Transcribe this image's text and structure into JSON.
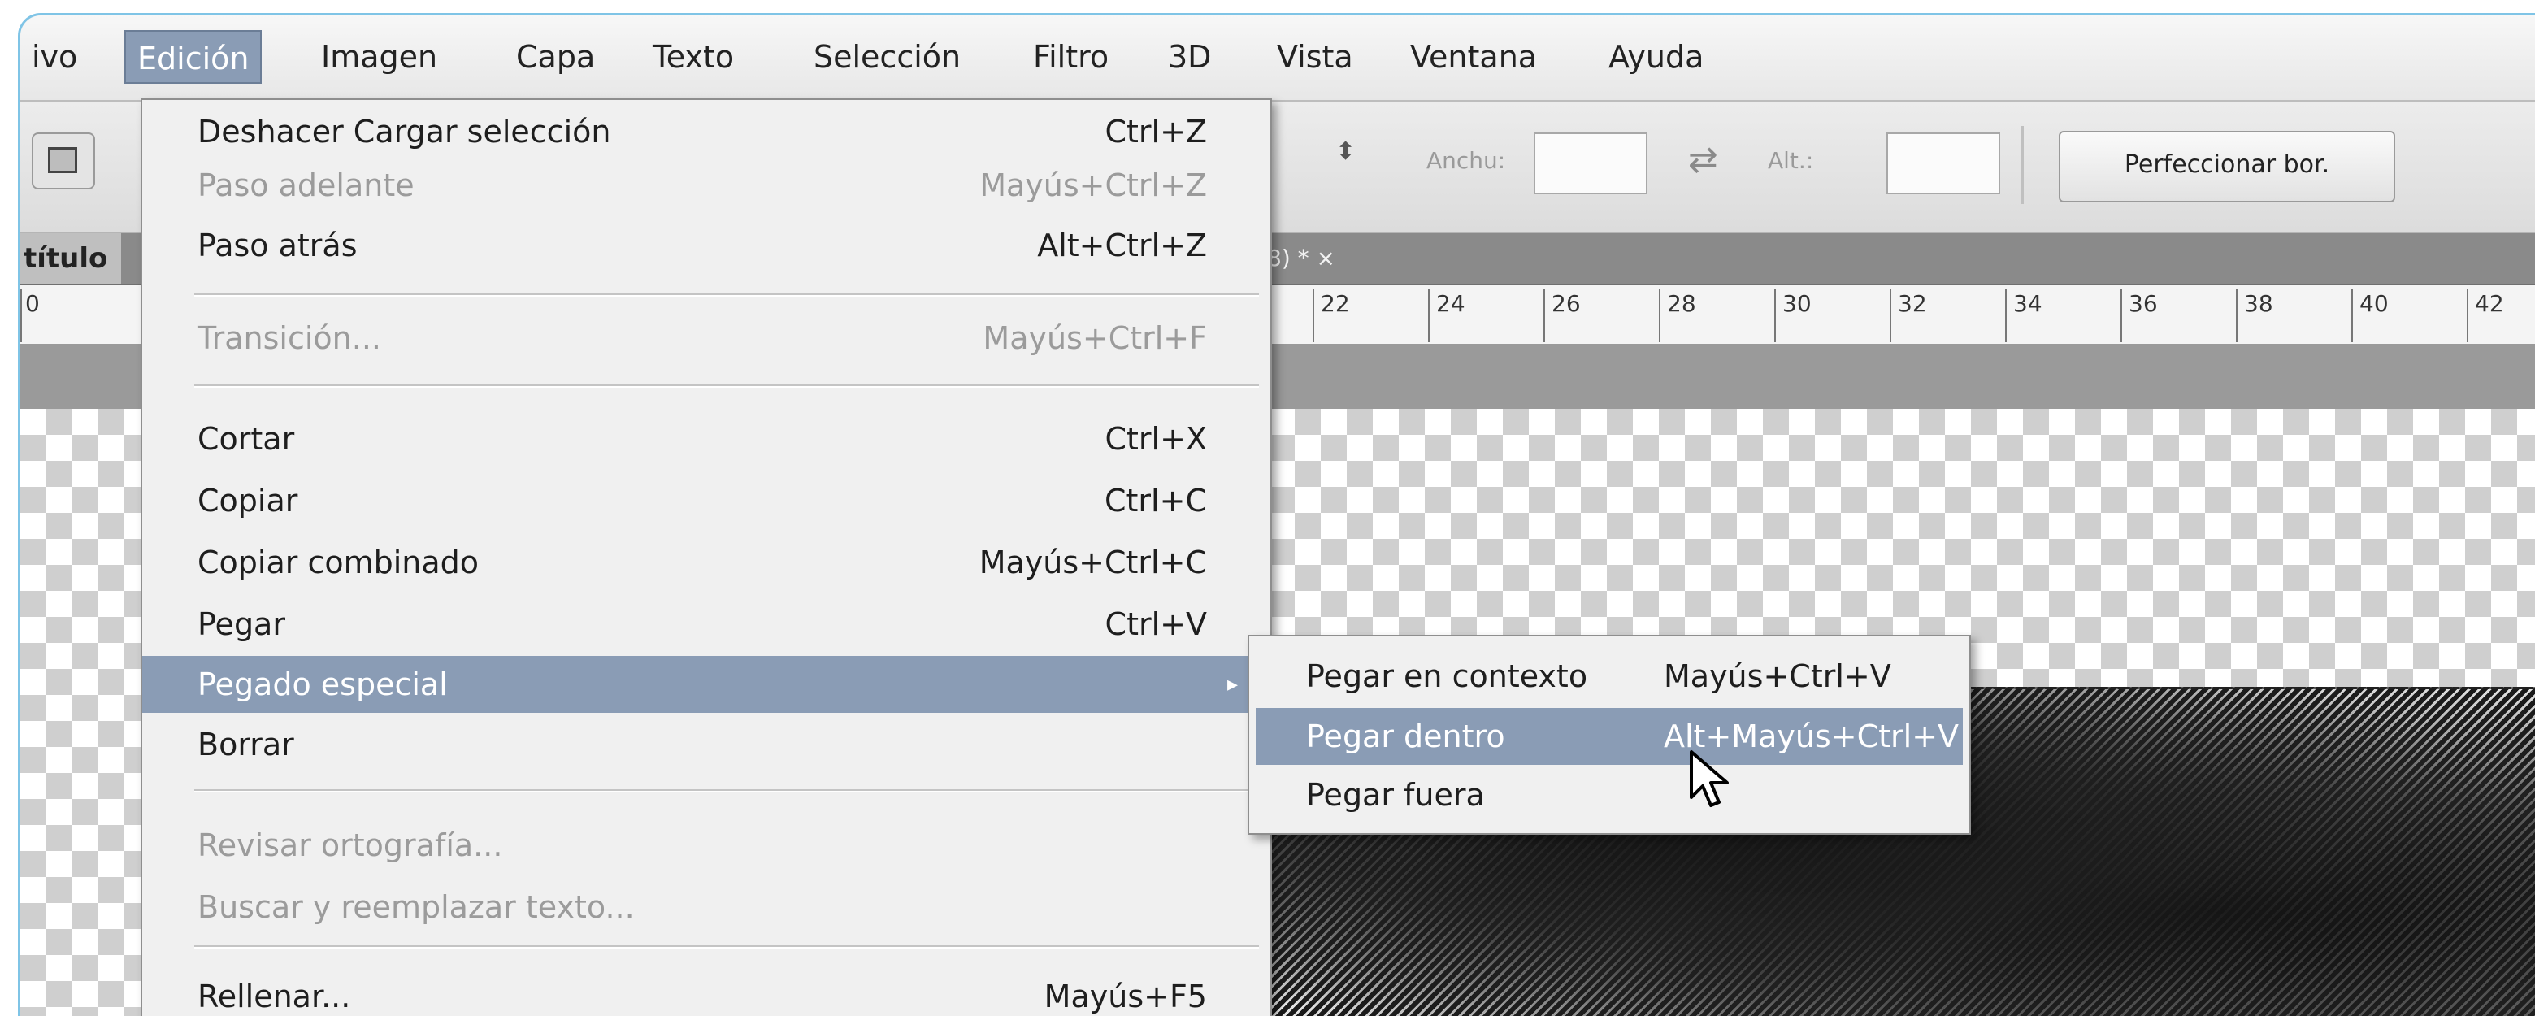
{
  "menubar": {
    "items": [
      "ivo",
      "Edición",
      "Imagen",
      "Capa",
      "Texto",
      "Selección",
      "Filtro",
      "3D",
      "Vista",
      "Ventana",
      "Ayuda"
    ],
    "active": "Edición"
  },
  "options_bar": {
    "width_label": "Anchu:",
    "height_label": "Alt.:",
    "refine_button": "Perfeccionar bor."
  },
  "document": {
    "tab_left": "título",
    "tab_fragment": "8) *  ×"
  },
  "ruler": {
    "labels": [
      "0",
      "22",
      "24",
      "26",
      "28",
      "30",
      "32",
      "34",
      "36",
      "38",
      "40",
      "42"
    ]
  },
  "edit_menu": {
    "items": [
      {
        "label": "Deshacer Cargar selección",
        "shortcut": "Ctrl+Z",
        "enabled": true
      },
      {
        "label": "Paso adelante",
        "shortcut": "Mayús+Ctrl+Z",
        "enabled": false
      },
      {
        "label": "Paso atrás",
        "shortcut": "Alt+Ctrl+Z",
        "enabled": true
      },
      {
        "label": "Transición...",
        "shortcut": "Mayús+Ctrl+F",
        "enabled": false
      },
      {
        "label": "Cortar",
        "shortcut": "Ctrl+X",
        "enabled": true
      },
      {
        "label": "Copiar",
        "shortcut": "Ctrl+C",
        "enabled": true
      },
      {
        "label": "Copiar combinado",
        "shortcut": "Mayús+Ctrl+C",
        "enabled": true
      },
      {
        "label": "Pegar",
        "shortcut": "Ctrl+V",
        "enabled": true
      },
      {
        "label": "Pegado especial",
        "shortcut": "",
        "enabled": true,
        "highlighted": true,
        "has_submenu": true
      },
      {
        "label": "Borrar",
        "shortcut": "",
        "enabled": true
      },
      {
        "label": "Revisar ortografía...",
        "shortcut": "",
        "enabled": false
      },
      {
        "label": "Buscar y reemplazar texto...",
        "shortcut": "",
        "enabled": false
      },
      {
        "label": "Rellenar...",
        "shortcut": "Mayús+F5",
        "enabled": true
      }
    ],
    "submenu_arrow": "▸"
  },
  "paste_special_submenu": {
    "items": [
      {
        "label": "Pegar en contexto",
        "shortcut": "Mayús+Ctrl+V"
      },
      {
        "label": "Pegar dentro",
        "shortcut": "Alt+Mayús+Ctrl+V",
        "highlighted": true
      },
      {
        "label": "Pegar fuera",
        "shortcut": ""
      }
    ]
  },
  "colors": {
    "highlight": "#8a9cb5",
    "frame_border": "#7fc4e6",
    "menu_bg": "#f0f0f0",
    "disabled_text": "#9b9b9b"
  },
  "icons": [
    "rectangle-marquee-icon",
    "select-arrows-icon",
    "swap-arrows-icon",
    "submenu-arrow-icon",
    "mouse-pointer-icon"
  ]
}
